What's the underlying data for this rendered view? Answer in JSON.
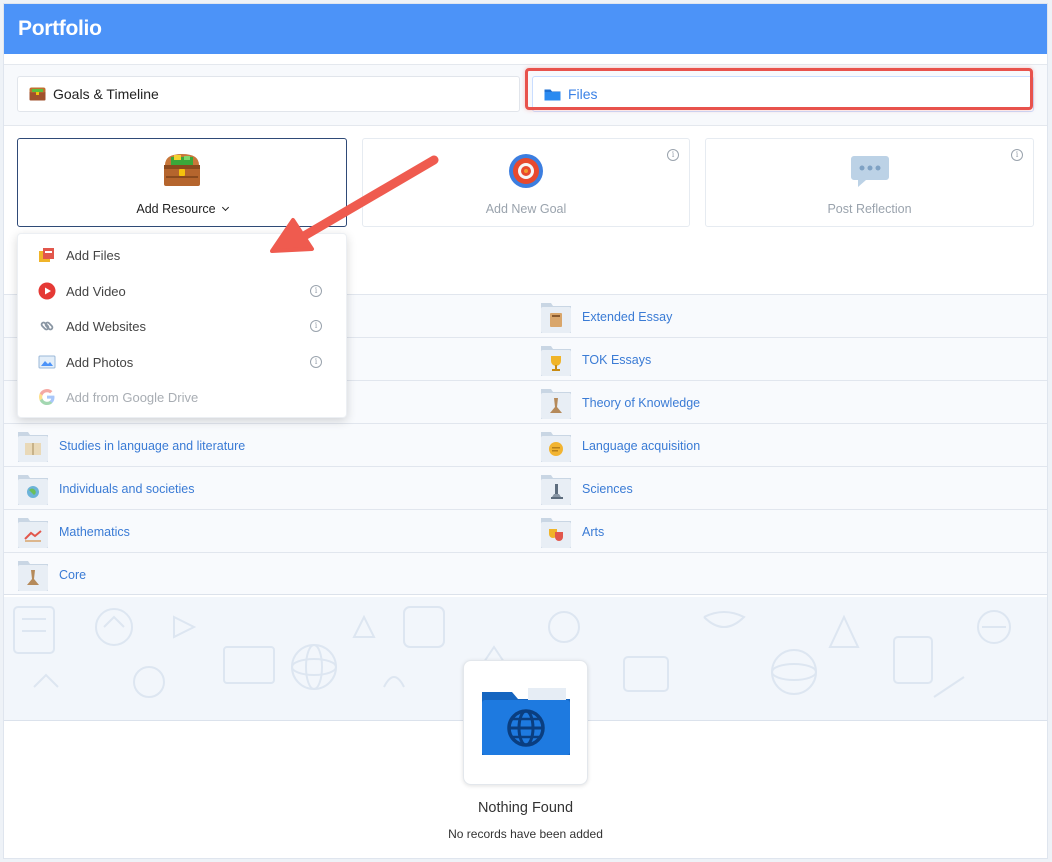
{
  "header": {
    "title": "Portfolio"
  },
  "tabs": [
    {
      "label": "Goals & Timeline",
      "icon": "treasure-chest-icon"
    },
    {
      "label": "Files",
      "icon": "folder-icon",
      "active": true
    }
  ],
  "actions": [
    {
      "label": "Add Resource",
      "icon": "treasure-chest-icon"
    },
    {
      "label": "Add New Goal",
      "icon": "target-icon"
    },
    {
      "label": "Post Reflection",
      "icon": "chat-bubble-icon"
    }
  ],
  "dropdown": {
    "items": [
      {
        "label": "Add Files",
        "icon": "files-icon"
      },
      {
        "label": "Add Video",
        "icon": "play-icon"
      },
      {
        "label": "Add Websites",
        "icon": "link-icon"
      },
      {
        "label": "Add Photos",
        "icon": "photo-icon"
      },
      {
        "label": "Add from Google Drive",
        "icon": "google-icon",
        "disabled": true
      }
    ]
  },
  "folders": {
    "left": [
      {
        "label": "Studies in language and literature"
      },
      {
        "label": "Individuals and societies"
      },
      {
        "label": "Mathematics"
      },
      {
        "label": "Core"
      }
    ],
    "right": [
      {
        "label": "Extended Essay"
      },
      {
        "label": "TOK Essays"
      },
      {
        "label": "Theory of Knowledge"
      },
      {
        "label": "Language acquisition"
      },
      {
        "label": "Sciences"
      },
      {
        "label": "Arts"
      }
    ]
  },
  "empty_state": {
    "title": "Nothing Found",
    "subtitle": "No records have been added"
  },
  "colors": {
    "header": "#4c93f8",
    "link": "#3a7bd5",
    "highlight": "#e8524c"
  }
}
